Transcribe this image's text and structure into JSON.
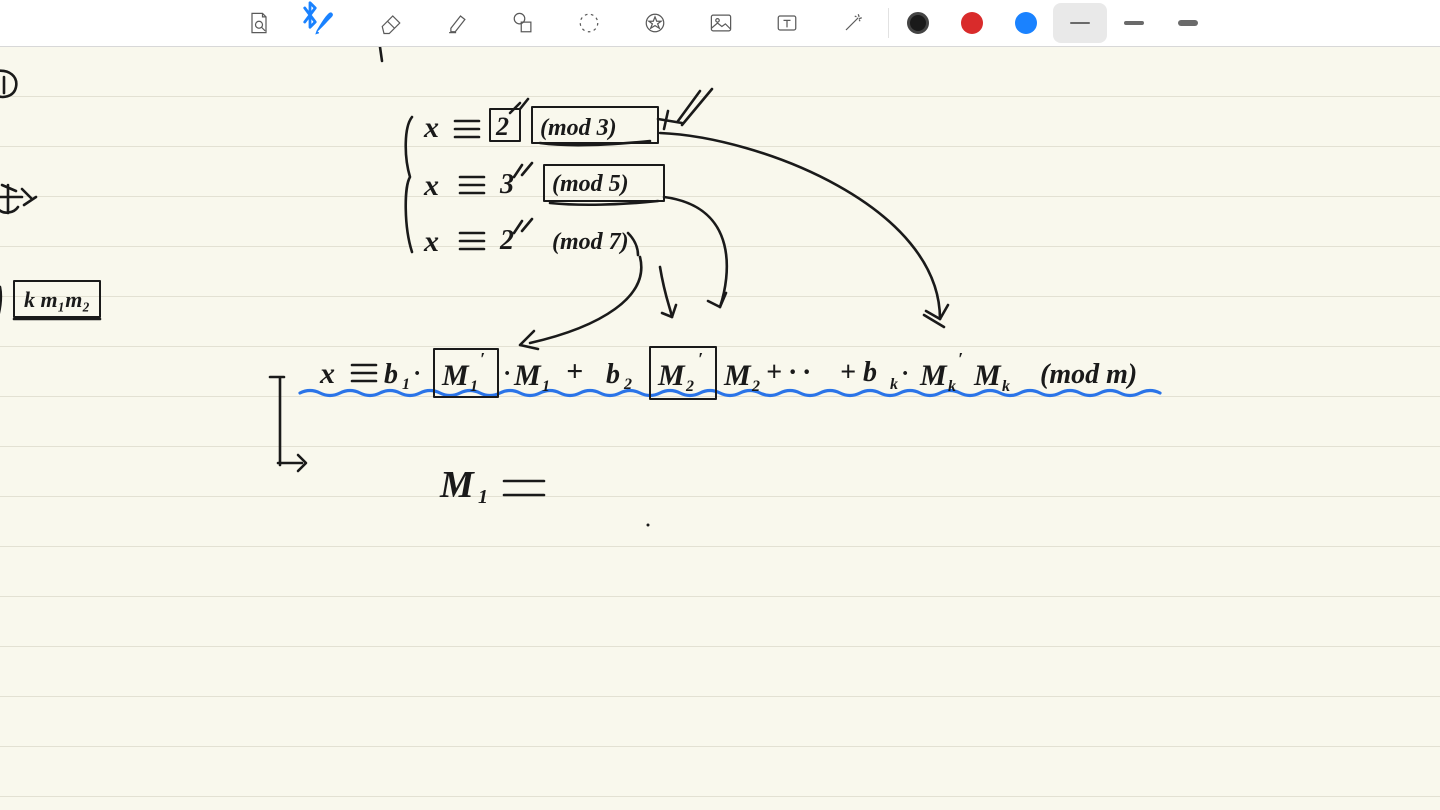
{
  "toolbar": {
    "tools": {
      "find": "find-on-page-icon",
      "pen": "pen-icon",
      "eraser": "eraser-icon",
      "highlighter": "highlighter-icon",
      "shapes": "shapes-icon",
      "lasso": "lasso-icon",
      "stamp": "stamp-icon",
      "image": "image-icon",
      "text": "text-icon",
      "wand": "wand-icon"
    },
    "active_tool": "pen",
    "bluetooth_connected": true,
    "colors": {
      "black": "#1a1a1a",
      "red": "#d92b2b",
      "blue": "#1a82ff",
      "selected": "black"
    },
    "stroke_widths": [
      "thin",
      "medium",
      "thick"
    ],
    "selected_stroke": "thin"
  },
  "handwriting": {
    "marginal_number": "D",
    "marginal_text_cn": "数",
    "system_brace": true,
    "congruences": [
      {
        "lhs": "x",
        "rel": "≡",
        "b": "2",
        "mod": "mod 3"
      },
      {
        "lhs": "x",
        "rel": "≡",
        "b": "3",
        "mod": "mod 5"
      },
      {
        "lhs": "x",
        "rel": "≡",
        "b": "2",
        "mod": "mod 7"
      }
    ],
    "crt_formula": "x ≡ b₁·M₁'·M₁ + b₂·M₂'·M₂ + … + bₖ·Mₖ'·Mₖ (mod m)",
    "next_line": "M₁ =",
    "boxed_terms": [
      "2",
      "mod 3",
      "mod 5",
      "M₁'",
      "M₂'"
    ],
    "side_box": "k m₁m₂",
    "underline_color": "blue"
  }
}
